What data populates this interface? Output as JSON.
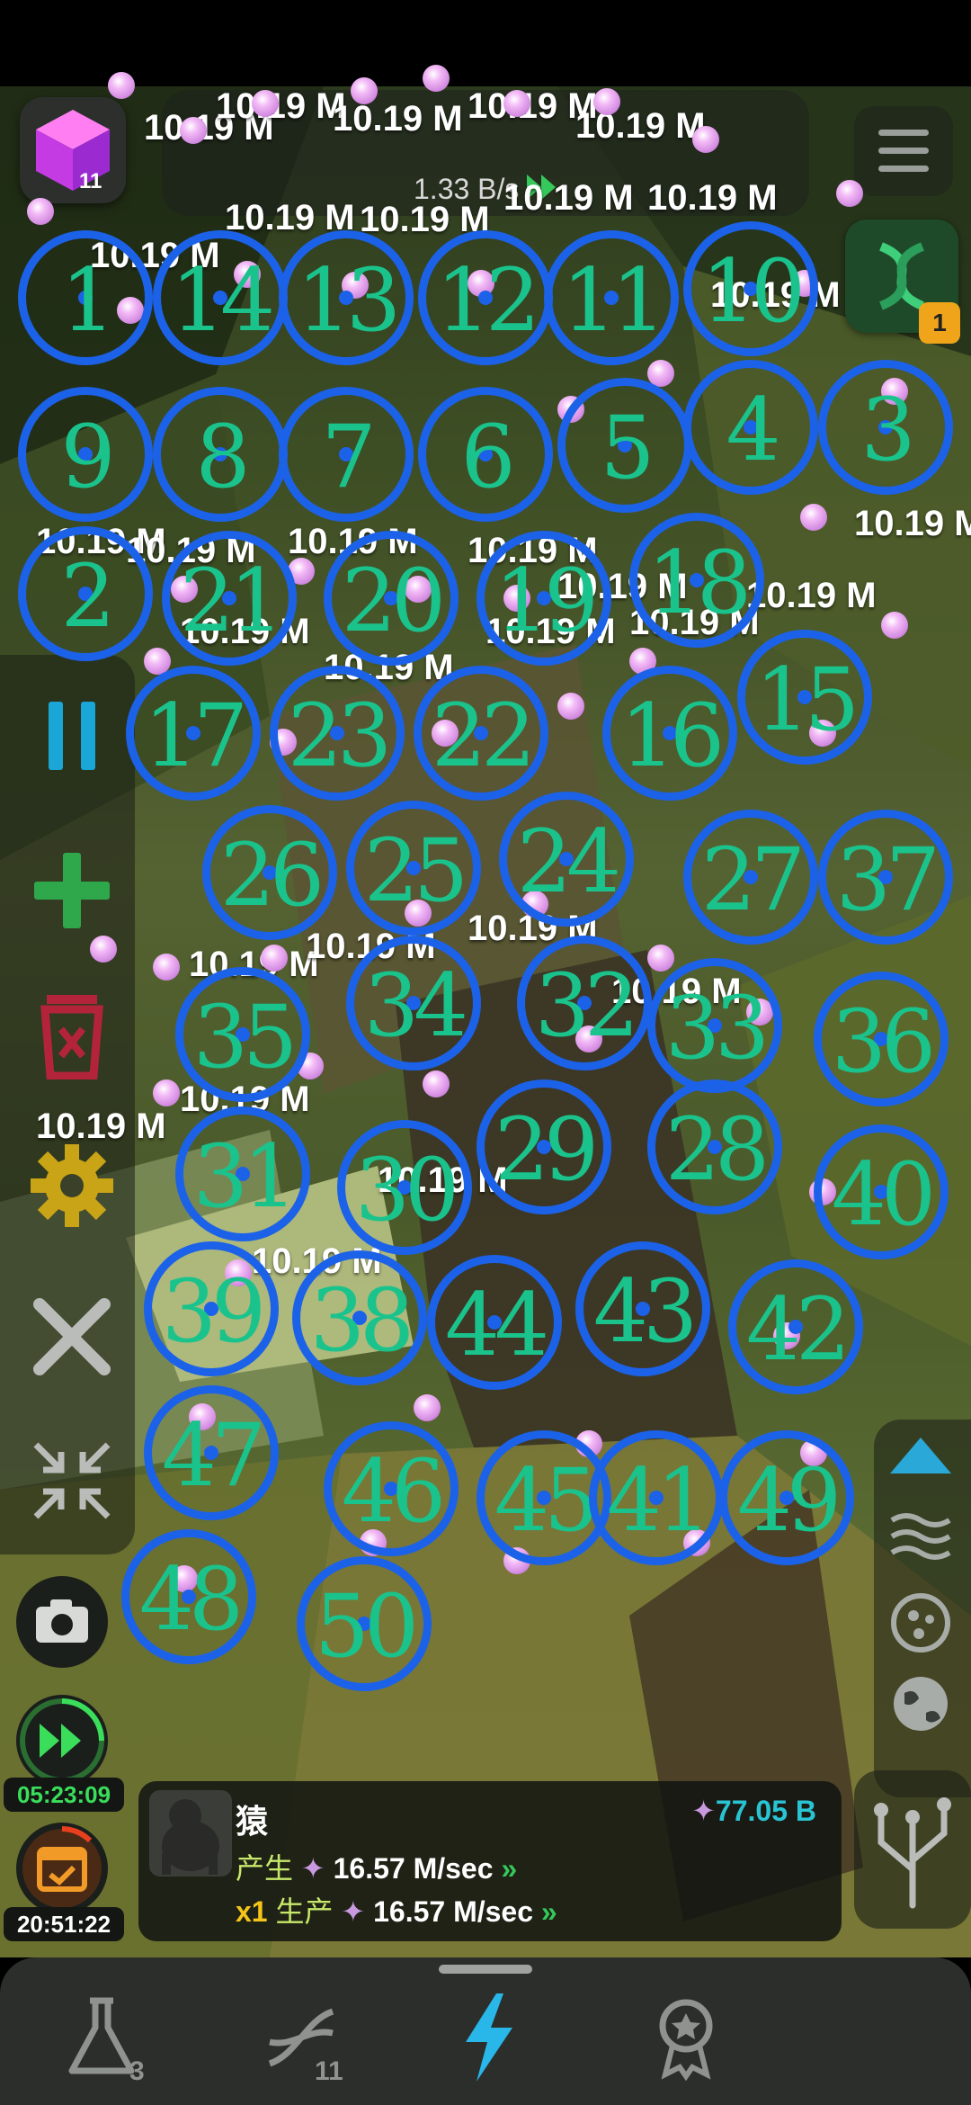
{
  "app": {
    "cube_count": "11",
    "production_rate": "1.33 B/s",
    "dna_badge": "1"
  },
  "floating_labels": [
    "10.19 M",
    "10.19 M",
    "10.19 M",
    "10.19 M",
    "10.19 M",
    "10.19 M",
    "10.19 M",
    "10.19 M",
    "10.19 M",
    "10.19 M",
    "10.19 M",
    "10.19 M",
    "10.19 M",
    "10.19 M",
    "10.19 M",
    "10.19 M",
    "10.19 M",
    "10.19 M",
    "10.19 M",
    "10.19 M",
    "10.19 M",
    "10.19 M",
    "10.19 M",
    "10.19 M",
    "10.19 M",
    "10.19 M",
    "10.19 M",
    "10.19 M",
    "10.19 M",
    "10.19 M"
  ],
  "bubbles": [
    {
      "n": "1"
    },
    {
      "n": "14"
    },
    {
      "n": "13"
    },
    {
      "n": "12"
    },
    {
      "n": "11"
    },
    {
      "n": "10"
    },
    {
      "n": "9"
    },
    {
      "n": "8"
    },
    {
      "n": "7"
    },
    {
      "n": "6"
    },
    {
      "n": "5"
    },
    {
      "n": "4"
    },
    {
      "n": "3"
    },
    {
      "n": "2"
    },
    {
      "n": "21"
    },
    {
      "n": "20"
    },
    {
      "n": "19"
    },
    {
      "n": "18"
    },
    {
      "n": "17"
    },
    {
      "n": "23"
    },
    {
      "n": "22"
    },
    {
      "n": "16"
    },
    {
      "n": "15"
    },
    {
      "n": "26"
    },
    {
      "n": "25"
    },
    {
      "n": "24"
    },
    {
      "n": "27"
    },
    {
      "n": "37"
    },
    {
      "n": "35"
    },
    {
      "n": "34"
    },
    {
      "n": "32"
    },
    {
      "n": "33"
    },
    {
      "n": "36"
    },
    {
      "n": "31"
    },
    {
      "n": "30"
    },
    {
      "n": "29"
    },
    {
      "n": "28"
    },
    {
      "n": "40"
    },
    {
      "n": "39"
    },
    {
      "n": "38"
    },
    {
      "n": "44"
    },
    {
      "n": "43"
    },
    {
      "n": "42"
    },
    {
      "n": "47"
    },
    {
      "n": "46"
    },
    {
      "n": "45"
    },
    {
      "n": "41"
    },
    {
      "n": "49"
    },
    {
      "n": "48"
    },
    {
      "n": "50"
    }
  ],
  "timers": {
    "boost": "05:23:09",
    "daily": "20:51:22"
  },
  "info_card": {
    "name": "猿",
    "total": "77.05 B",
    "produce_label": "产生",
    "produce_value": "16.57 M/sec",
    "multiplier": "x1",
    "production_label": "生产",
    "production_value": "16.57 M/sec"
  },
  "nav": {
    "lab_badge": "3",
    "dna_badge": "11"
  },
  "colors": {
    "accent_green": "#1bc38c",
    "bubble_blue": "#1c62e8",
    "total_cyan": "#29c4d4",
    "multiplier_yellow": "#f4c518"
  },
  "icons": [
    "pink-cube-icon",
    "fast-forward-icon",
    "menu-icon",
    "dna-icon",
    "pause-icon",
    "plus-icon",
    "trash-icon",
    "gear-icon",
    "close-icon",
    "compress-icon",
    "camera-icon",
    "calendar-icon",
    "up-arrow-icon",
    "waves-icon",
    "cell-icon",
    "globe-icon",
    "tree-icon",
    "flask-icon",
    "lightning-icon",
    "award-icon"
  ]
}
